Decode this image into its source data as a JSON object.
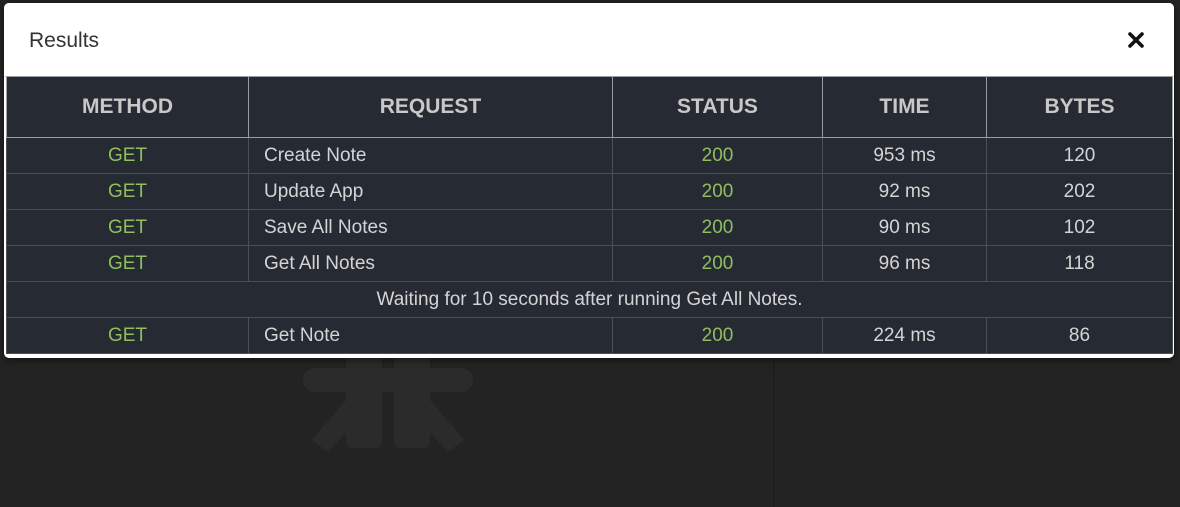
{
  "modal": {
    "title": "Results",
    "close_icon": "close-icon"
  },
  "table": {
    "headers": [
      "METHOD",
      "REQUEST",
      "STATUS",
      "TIME",
      "BYTES"
    ],
    "rows": [
      {
        "method": "GET",
        "request": "Create Note",
        "status": "200",
        "time": "953 ms",
        "bytes": "120"
      },
      {
        "method": "GET",
        "request": "Update App",
        "status": "200",
        "time": "92 ms",
        "bytes": "202"
      },
      {
        "method": "GET",
        "request": "Save All Notes",
        "status": "200",
        "time": "90 ms",
        "bytes": "102"
      },
      {
        "method": "GET",
        "request": "Get All Notes",
        "status": "200",
        "time": "96 ms",
        "bytes": "118"
      }
    ],
    "wait_note": "Waiting for 10 seconds after running Get All Notes.",
    "rows_after": [
      {
        "method": "GET",
        "request": "Get Note",
        "status": "200",
        "time": "224 ms",
        "bytes": "86"
      }
    ]
  },
  "colors": {
    "success": "#8fbf5e",
    "table_bg": "#262a33",
    "page_bg": "#232323"
  }
}
